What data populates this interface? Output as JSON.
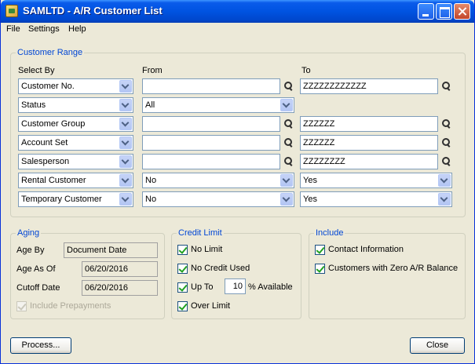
{
  "window": {
    "title": "SAMLTD - A/R Customer List"
  },
  "menu": {
    "file": "File",
    "settings": "Settings",
    "help": "Help"
  },
  "customer_range": {
    "title": "Customer Range",
    "select_by_label": "Select By",
    "from_label": "From",
    "to_label": "To",
    "rows": [
      {
        "select": "Customer No.",
        "from": "",
        "to": "ZZZZZZZZZZZZ"
      },
      {
        "select": "Status",
        "from": "All",
        "to": ""
      },
      {
        "select": "Customer Group",
        "from": "",
        "to": "ZZZZZZ"
      },
      {
        "select": "Account Set",
        "from": "",
        "to": "ZZZZZZ"
      },
      {
        "select": "Salesperson",
        "from": "",
        "to": "ZZZZZZZZ"
      },
      {
        "select": "Rental Customer",
        "from": "No",
        "to": "Yes"
      },
      {
        "select": "Temporary Customer",
        "from": "No",
        "to": "Yes"
      }
    ]
  },
  "aging": {
    "title": "Aging",
    "age_by_label": "Age By",
    "age_by_value": "Document Date",
    "age_as_of_label": "Age As Of",
    "age_as_of_value": "06/20/2016",
    "cutoff_date_label": "Cutoff Date",
    "cutoff_date_value": "06/20/2016",
    "include_prepayments_label": "Include Prepayments"
  },
  "credit_limit": {
    "title": "Credit Limit",
    "no_limit": "No Limit",
    "no_credit_used": "No Credit Used",
    "up_to": "Up To",
    "up_to_value": "10",
    "percent_available": "% Available",
    "over_limit": "Over Limit"
  },
  "include": {
    "title": "Include",
    "contact_information": "Contact Information",
    "zero_balance": "Customers with Zero A/R Balance"
  },
  "buttons": {
    "process": "Process...",
    "close": "Close"
  }
}
